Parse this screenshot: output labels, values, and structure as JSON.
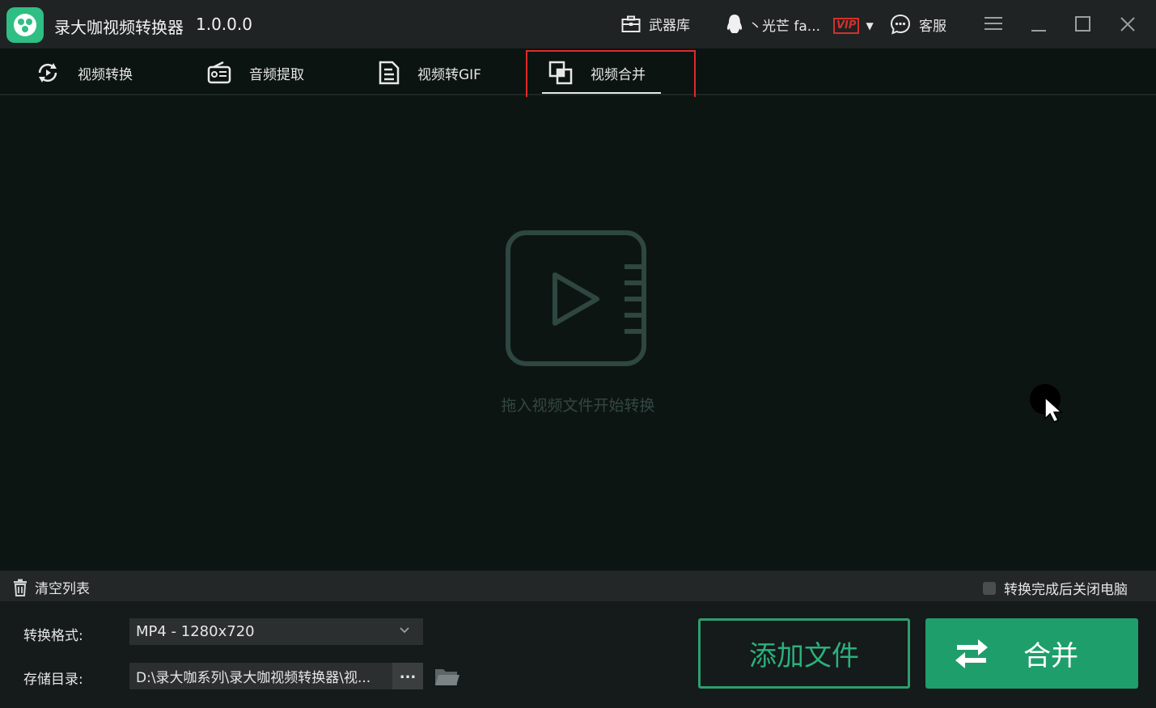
{
  "window": {
    "app_title": "录大咖视频转换器",
    "version": "1.0.0.0",
    "arsenal_label": "武器库",
    "user_name": "丶光芒 fa...",
    "vip_label": "VIP",
    "service_label": "客服",
    "icons": [
      "app-logo-icon",
      "toolbox-icon",
      "qq-penguin-icon",
      "chat-bubble-icon",
      "hamburger-menu-icon",
      "minimize-icon",
      "maximize-icon",
      "close-icon"
    ]
  },
  "tabs": [
    {
      "label": "视频转换",
      "icon": "refresh-cycle-icon"
    },
    {
      "label": "音频提取",
      "icon": "radio-icon"
    },
    {
      "label": "视频转GIF",
      "icon": "document-icon"
    },
    {
      "label": "视频合并",
      "icon": "merge-layers-icon",
      "active": true
    }
  ],
  "drop_area": {
    "hint": "拖入视频文件开始转换",
    "icon": "video-play-icon"
  },
  "list_bar": {
    "clear_label": "清空列表",
    "shutdown_label": "转换完成后关闭电脑",
    "shutdown_checked": false
  },
  "settings": {
    "format_label": "转换格式:",
    "format_value": "MP4 - 1280x720",
    "dir_label": "存储目录:",
    "dir_value": "D:\\录大咖系列\\录大咖视频转换器\\视...",
    "dir_browse_label": "..."
  },
  "actions": {
    "add_label": "添加文件",
    "merge_label": "合并"
  },
  "colors": {
    "accent": "#1e9e6b",
    "highlight_box": "#e12a2a",
    "vip": "#d2312b"
  }
}
